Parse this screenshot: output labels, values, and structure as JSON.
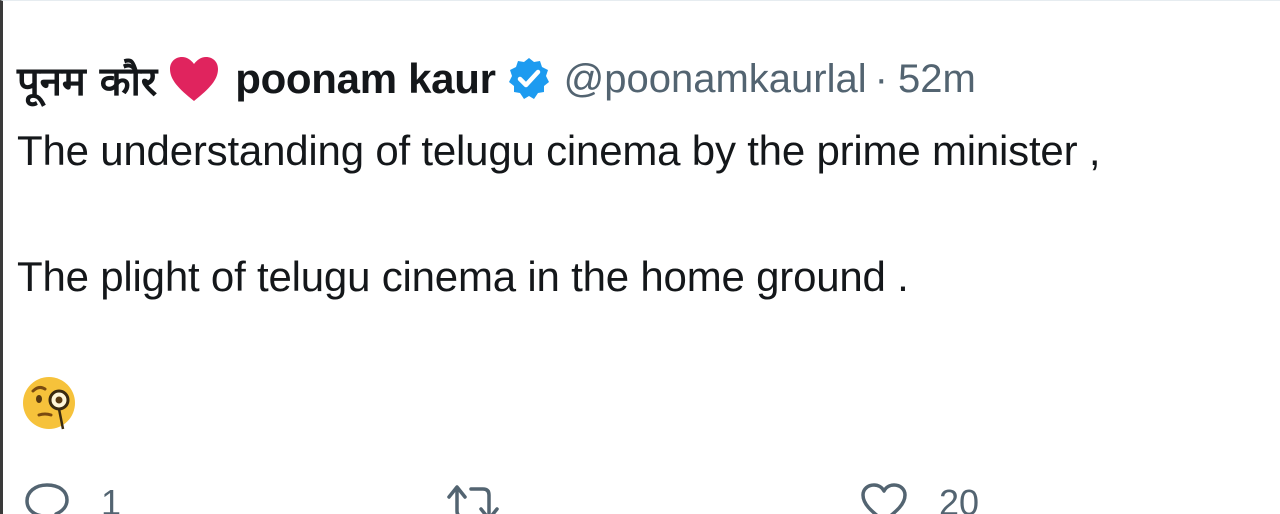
{
  "author": {
    "hindi_name": "पूनम कौर",
    "display_name": "poonam kaur",
    "handle": "@poonamkaurlal",
    "separator": "·",
    "time": "52m",
    "verified": true
  },
  "tweet": {
    "line1": "The understanding of telugu cinema by the prime minister ,",
    "line2": "The plight of telugu cinema in the home ground ."
  },
  "icons": {
    "heart": "red-heart-icon",
    "verified": "verified-badge-icon",
    "emoji": "face-with-monocle-icon",
    "reply": "reply-icon",
    "retweet": "retweet-icon",
    "like": "like-icon"
  },
  "colors": {
    "heart": "#e0245e",
    "verified": "#1d9bf0",
    "secondary_text": "#536471",
    "primary_text": "#14171a"
  },
  "actions": {
    "reply_count": "1",
    "like_count": "20"
  }
}
